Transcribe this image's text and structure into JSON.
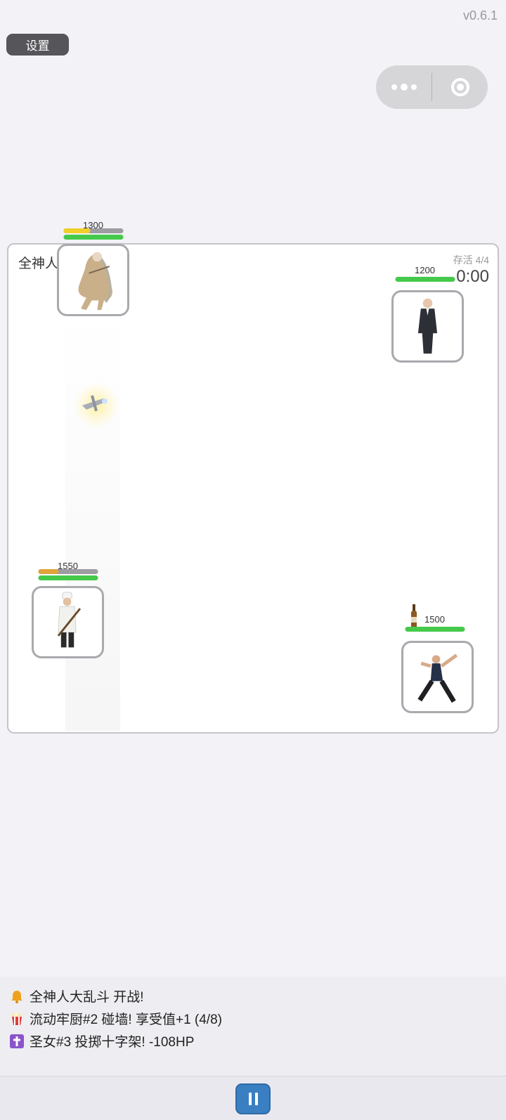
{
  "version": "v0.6.1",
  "settings_label": "设置",
  "capsule": {
    "menu_icon": "more-dots-icon",
    "close_icon": "target-circle-icon"
  },
  "arena": {
    "title": "全神人大乱斗",
    "alive": "存活 4/4",
    "timer": "0:00"
  },
  "fighters": [
    {
      "id": "saintess",
      "hp": "1300",
      "bar_color": "#45c94b",
      "top_bar_color": "#f1cf2a",
      "top_bar_level": 0.45,
      "hp_level": 1.0
    },
    {
      "id": "suit-man",
      "hp": "1200",
      "bar_color": "#45c94b",
      "hp_level": 1.0
    },
    {
      "id": "chef",
      "hp": "1550",
      "bar_color": "#45c94b",
      "top_bar_color": "#e0a43b",
      "top_bar_level": 0.35,
      "hp_level": 1.0
    },
    {
      "id": "thrower",
      "hp": "1500",
      "bar_color": "#45c94b",
      "hp_level": 1.0
    }
  ],
  "log": [
    {
      "icon": "bell-icon",
      "text": "全神人大乱斗 开战!"
    },
    {
      "icon": "popcorn-icon",
      "text": "流动牢厨#2 碰墙! 享受值+1 (4/8)"
    },
    {
      "icon": "cross-icon",
      "text": "圣女#3 投掷十字架! -108HP"
    }
  ],
  "controls": {
    "pause_icon": "pause-icon"
  }
}
